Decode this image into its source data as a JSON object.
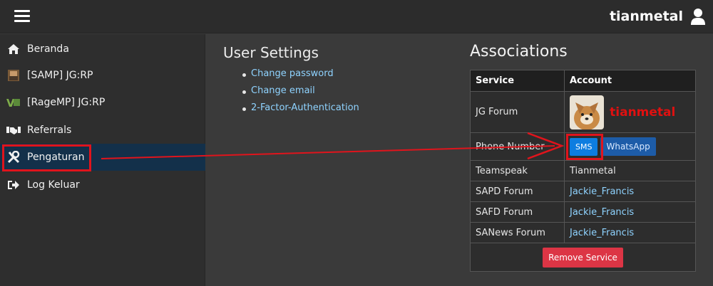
{
  "header": {
    "username": "tianmetal"
  },
  "sidebar": {
    "items": [
      {
        "label": "Beranda",
        "icon": "home-icon"
      },
      {
        "label": "[SAMP] JG:RP",
        "icon": "samp-icon"
      },
      {
        "label": "[RageMP] JG:RP",
        "icon": "ragemp-icon"
      },
      {
        "label": "Referrals",
        "icon": "handshake-icon"
      },
      {
        "label": "Pengaturan",
        "icon": "wrench-screwdriver-icon",
        "active": true
      },
      {
        "label": "Log Keluar",
        "icon": "logout-icon"
      }
    ]
  },
  "user_settings": {
    "title": "User Settings",
    "links": [
      "Change password",
      "Change email",
      "2-Factor-Authentication"
    ]
  },
  "associations": {
    "title": "Associations",
    "headers": {
      "service": "Service",
      "account": "Account"
    },
    "rows": {
      "jg_forum": {
        "service": "JG Forum",
        "account": "tianmetal"
      },
      "phone": {
        "service": "Phone Number",
        "sms": "SMS",
        "whatsapp": "WhatsApp"
      },
      "teamspeak": {
        "service": "Teamspeak",
        "account": "Tianmetal"
      },
      "sapd": {
        "service": "SAPD Forum",
        "account": "Jackie_Francis"
      },
      "safd": {
        "service": "SAFD Forum",
        "account": "Jackie_Francis"
      },
      "sanews": {
        "service": "SANews Forum",
        "account": "Jackie_Francis"
      }
    },
    "remove_label": "Remove Service"
  },
  "colors": {
    "accent_link": "#8fd3ff",
    "active_nav": "#13304a",
    "annotation_red": "#e0141c",
    "sms_button": "#0d7de0",
    "whatsapp_button": "#1d5ca8",
    "remove_button": "#dc3545"
  }
}
